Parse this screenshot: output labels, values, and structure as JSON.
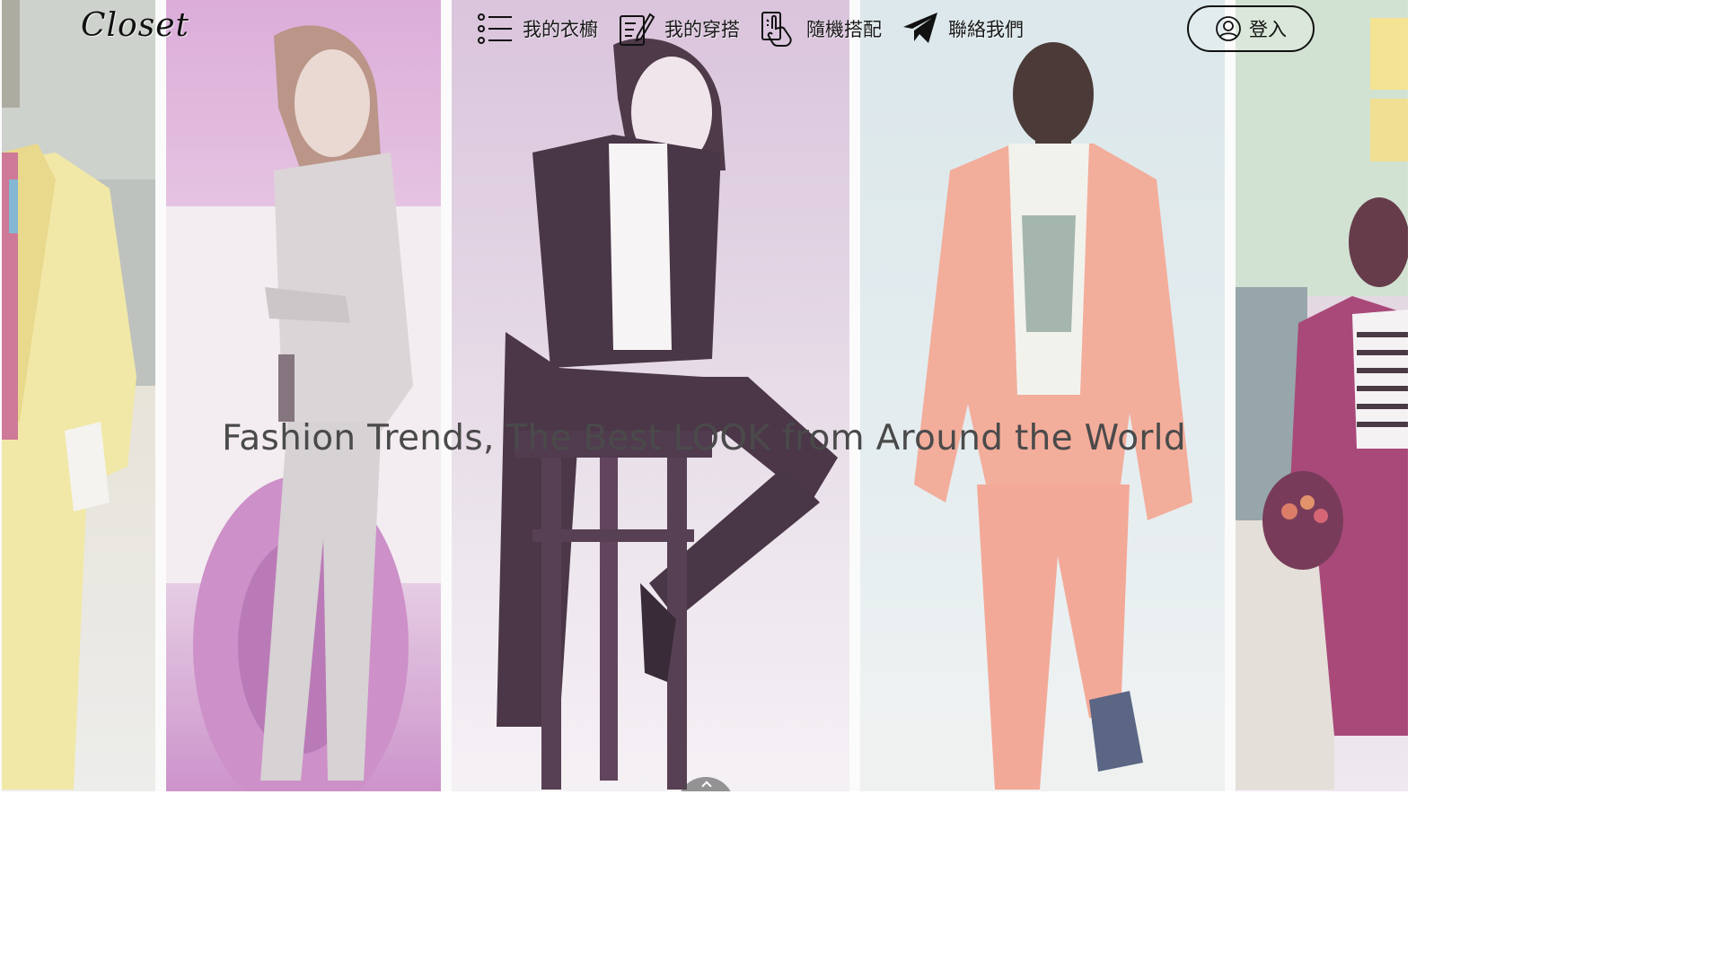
{
  "header": {
    "logo": "Closet",
    "nav": [
      {
        "label": "我的衣櫥",
        "icon": "list-icon"
      },
      {
        "label": "我的穿搭",
        "icon": "edit-note-icon"
      },
      {
        "label": "隨機搭配",
        "icon": "tap-hand-icon"
      },
      {
        "label": "聯絡我們",
        "icon": "paper-plane-icon"
      }
    ],
    "login": {
      "label": "登入",
      "icon": "user-circle-icon"
    }
  },
  "hero": {
    "tagline": "Fashion Trends, The Best LOOK from Around the World"
  },
  "panels": [
    {
      "name": "yellow-suit-photo",
      "tint": "#e8e4a8"
    },
    {
      "name": "grey-suit-photo",
      "tint": "#d9a7d6"
    },
    {
      "name": "black-suit-stool-photo",
      "tint": "#c9a9cf"
    },
    {
      "name": "peach-suit-photo",
      "tint": "#f2a996"
    },
    {
      "name": "street-style-photo",
      "tint": "#c86ea6"
    }
  ]
}
